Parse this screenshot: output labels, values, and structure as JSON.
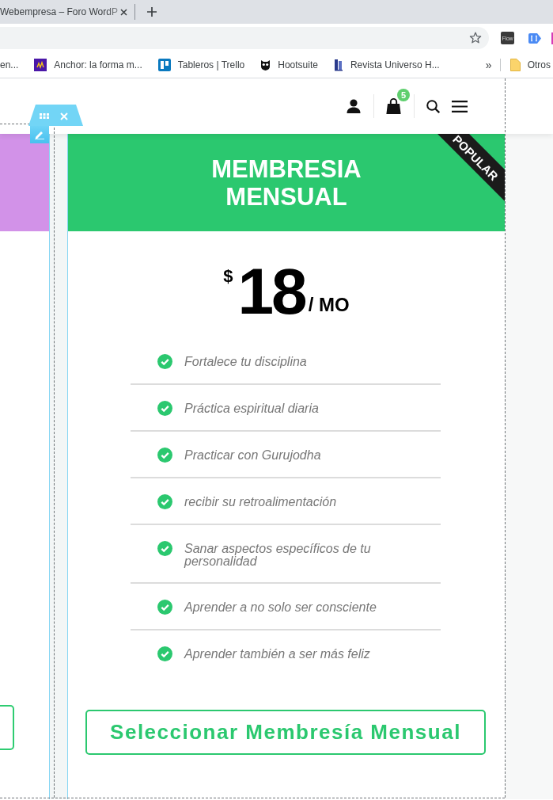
{
  "browser": {
    "tab": {
      "title": "Webempresa – Foro WordP"
    },
    "extensions": [
      {
        "kind": "logo",
        "label": "Flow"
      },
      {
        "kind": "tag"
      },
      {
        "kind": "partial"
      }
    ],
    "bookmarks": [
      {
        "kind": "plain",
        "title": "en..."
      },
      {
        "kind": "podcast",
        "title": "Anchor: la forma m..."
      },
      {
        "kind": "board",
        "title": "Tableros | Trello"
      },
      {
        "kind": "owl",
        "title": "Hootsuite"
      },
      {
        "kind": "book",
        "title": "Revista Universo H..."
      }
    ],
    "overflow": "»",
    "other_bookmarks": {
      "title": "Otros"
    }
  },
  "site_header": {
    "cart_count": "5"
  },
  "pricing_card": {
    "ribbon": "POPULAR",
    "title": "MEMBRESIA MENSUAL",
    "price": {
      "currency": "$",
      "amount": "18",
      "period": "/ MO"
    },
    "features": [
      "Fortalece tu disciplina",
      "Práctica espiritual diaria",
      "Practicar con Gurujodha",
      "recibir su retroalimentación",
      "Sanar aspectos específicos de tu personalidad",
      "Aprender a no solo ser consciente",
      "Aprender también a ser más feliz"
    ],
    "button": "Seleccionar Membresía Mensual"
  }
}
